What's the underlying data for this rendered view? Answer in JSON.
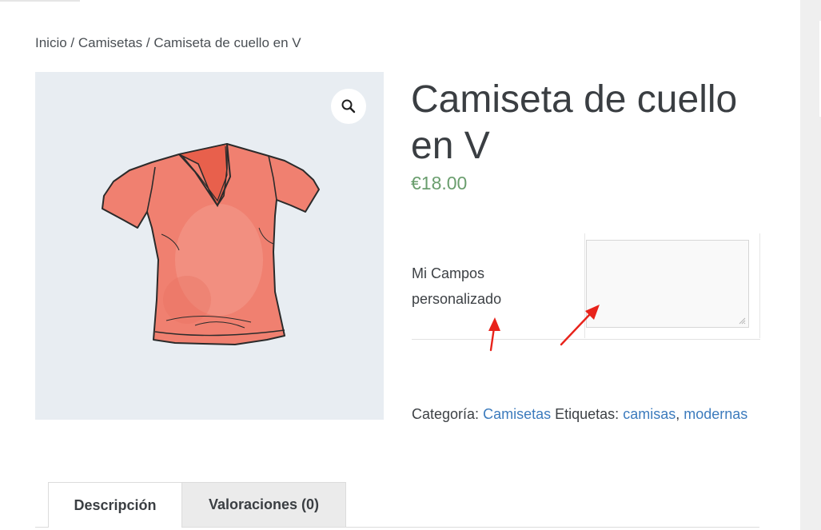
{
  "breadcrumb": "Inicio / Camisetas / Camiseta de cuello en V",
  "product": {
    "title": "Camiseta de cuello en V",
    "price": "€18.00",
    "zoom_icon": "magnifier-icon",
    "image_subject": "tshirt-illustration"
  },
  "custom_field": {
    "label": "Mi Campos personalizado",
    "value": ""
  },
  "meta": {
    "category_label": "Categoría:",
    "category_link": "Camisetas",
    "tags_label": "Etiquetas:",
    "tag_1": "camisas",
    "separator": ",",
    "tag_2": "modernas"
  },
  "tabs": [
    {
      "label": "Descripción",
      "active": true
    },
    {
      "label": "Valoraciones (0)",
      "active": false
    }
  ],
  "colors": {
    "price": "#6a9e6e",
    "link": "#3c7bbd",
    "shirt": "#f08070",
    "annotation": "#e8231b",
    "image_bg": "#e8edf2"
  }
}
